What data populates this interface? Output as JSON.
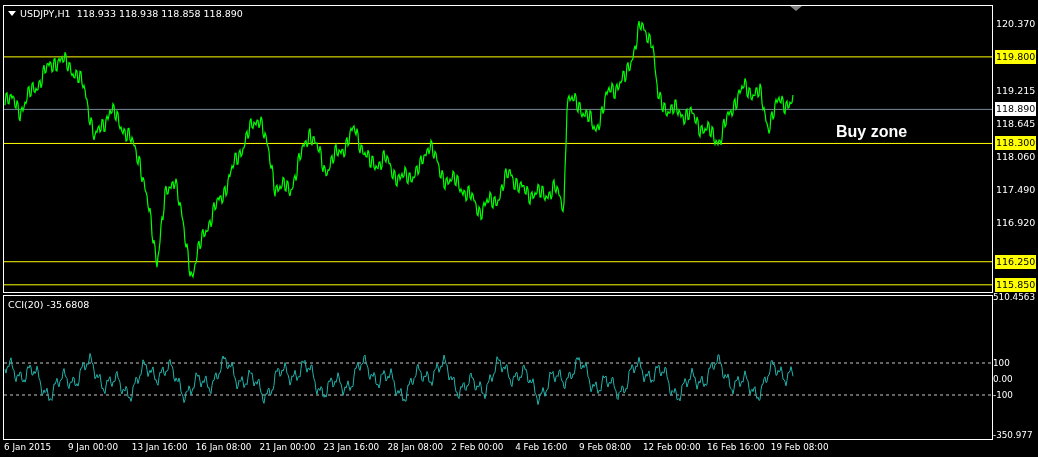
{
  "header": {
    "symbol": "USDJPY,H1",
    "prices": "118.933 118.938 118.858 118.890"
  },
  "price_axis": [
    "120.370",
    "119.215",
    "118.645",
    "118.060",
    "117.490",
    "116.920"
  ],
  "levels": [
    {
      "kind": "zone",
      "label": "119.800"
    },
    {
      "kind": "current",
      "label": "118.890"
    },
    {
      "kind": "zone",
      "label": "118.300"
    },
    {
      "kind": "zone",
      "label": "116.250"
    },
    {
      "kind": "zone",
      "label": "115.850"
    }
  ],
  "annotation": "Buy zone",
  "indicator": {
    "label": "CCI(20) -35.6808",
    "axis": [
      {
        "label": "510.4563",
        "dashed": false
      },
      {
        "label": "100",
        "dashed": true
      },
      {
        "label": "0.00",
        "dashed": false
      },
      {
        "label": "-100",
        "dashed": true
      },
      {
        "label": "-350.977",
        "dashed": false
      }
    ]
  },
  "time_axis": [
    "6 Jan 2015",
    "9 Jan 00:00",
    "13 Jan 16:00",
    "16 Jan 08:00",
    "21 Jan 00:00",
    "23 Jan 16:00",
    "28 Jan 08:00",
    "2 Feb 00:00",
    "4 Feb 16:00",
    "9 Feb 08:00",
    "12 Feb 00:00",
    "16 Feb 16:00",
    "19 Feb 08:00"
  ]
}
